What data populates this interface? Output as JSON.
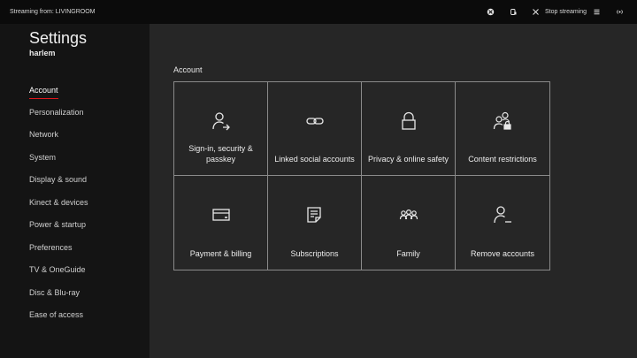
{
  "topbar": {
    "streaming_text": "Streaming from: LIVINGROOM",
    "stop_label": "Stop streaming",
    "icons": [
      "xbox-icon",
      "controller-icon",
      "close-icon",
      "menu-icon",
      "broadcast-icon"
    ]
  },
  "sidebar": {
    "title": "Settings",
    "user": "harlem",
    "items": [
      {
        "label": "Account",
        "active": true
      },
      {
        "label": "Personalization"
      },
      {
        "label": "Network"
      },
      {
        "label": "System"
      },
      {
        "label": "Display & sound"
      },
      {
        "label": "Kinect & devices"
      },
      {
        "label": "Power & startup"
      },
      {
        "label": "Preferences"
      },
      {
        "label": "TV & OneGuide"
      },
      {
        "label": "Disc & Blu-ray"
      },
      {
        "label": "Ease of access"
      }
    ]
  },
  "main": {
    "section": "Account",
    "tiles": [
      {
        "label": "Sign-in, security & passkey",
        "icon": "person-arrow-icon"
      },
      {
        "label": "Linked social accounts",
        "icon": "link-icon"
      },
      {
        "label": "Privacy & online safety",
        "icon": "lock-icon"
      },
      {
        "label": "Content restrictions",
        "icon": "people-lock-icon"
      },
      {
        "label": "Payment & billing",
        "icon": "credit-card-icon"
      },
      {
        "label": "Subscriptions",
        "icon": "document-list-icon"
      },
      {
        "label": "Family",
        "icon": "family-icon"
      },
      {
        "label": "Remove accounts",
        "icon": "person-minus-icon"
      }
    ]
  },
  "colors": {
    "background": "#262626",
    "sidebar": "#141414",
    "topbar": "#0b0b0b",
    "accent": "#e0161b",
    "tile_border": "#8a8a8a"
  }
}
